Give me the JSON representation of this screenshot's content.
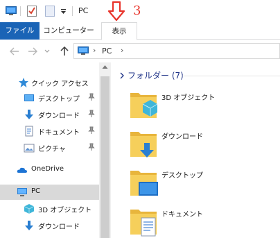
{
  "window": {
    "title": "PC"
  },
  "ribbon": {
    "tabs": [
      {
        "label": "ファイル"
      },
      {
        "label": "コンピューター"
      },
      {
        "label": "表示"
      }
    ]
  },
  "annotation": {
    "number": "3"
  },
  "address": {
    "location": "PC"
  },
  "nav": {
    "quick_access": "クイック アクセス",
    "pinned": [
      {
        "label": "デスクトップ"
      },
      {
        "label": "ダウンロード"
      },
      {
        "label": "ドキュメント"
      },
      {
        "label": "ピクチャ"
      }
    ],
    "onedrive": "OneDrive",
    "pc": "PC",
    "pc_children": [
      {
        "label": "3D オブジェクト"
      },
      {
        "label": "ダウンロード"
      }
    ]
  },
  "content": {
    "group_header": "フォルダー (7)",
    "folders": [
      {
        "name": "3D オブジェクト",
        "icon": "3d-objects-folder-icon"
      },
      {
        "name": "ダウンロード",
        "icon": "downloads-folder-icon"
      },
      {
        "name": "デスクトップ",
        "icon": "desktop-folder-icon"
      },
      {
        "name": "ドキュメント",
        "icon": "documents-folder-icon"
      }
    ]
  },
  "colors": {
    "accent": "#1a64b6",
    "annotation": "#e8332a",
    "header_text": "#1e3287",
    "folder": "#f5c84b"
  }
}
